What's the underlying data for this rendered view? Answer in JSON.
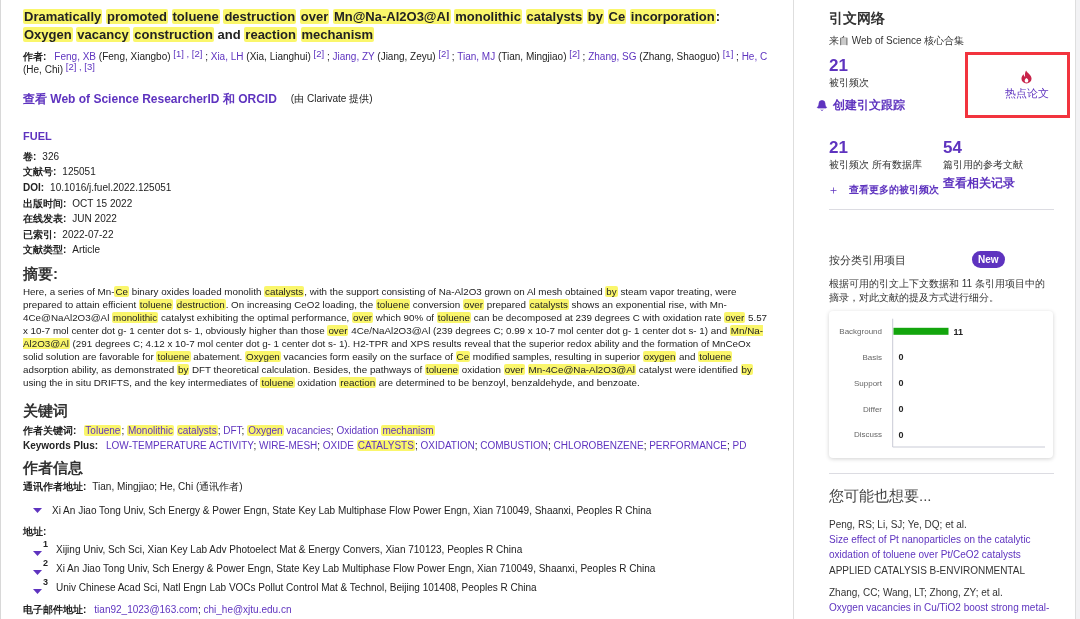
{
  "article": {
    "title": [
      {
        "text": "Dramatically ",
        "highlighted": true
      },
      {
        "text": "promoted ",
        "highlighted": true
      },
      {
        "text": "toluene ",
        "highlighted": true
      },
      {
        "text": "destruction ",
        "highlighted": true
      },
      {
        "text": "over ",
        "highlighted": true
      },
      {
        "text": "Mn@Na-Al2O3@Al ",
        "highlighted": true
      },
      {
        "text": "monolithic ",
        "highlighted": true
      },
      {
        "text": "catalysts ",
        "highlighted": true
      },
      {
        "text": "by ",
        "highlighted": true
      },
      {
        "text": "Ce ",
        "highlighted": true
      },
      {
        "text": "incorporation",
        "highlighted": true
      },
      {
        "text": ": ",
        "highlighted": false
      },
      {
        "text": "Oxygen ",
        "highlighted": true
      },
      {
        "text": "vacancy ",
        "highlighted": true
      },
      {
        "text": "construction",
        "highlighted": true
      },
      {
        "text": " and ",
        "highlighted": false
      },
      {
        "text": "reaction ",
        "highlighted": true
      },
      {
        "text": "mechanism",
        "highlighted": true
      }
    ],
    "authors": {
      "label": "作者:",
      "items": [
        {
          "short": "Feng, XB",
          "full": "(Feng, Xiangbo)",
          "refs": [
            {
              "label": "[1]",
              "separator": ","
            },
            {
              "label": "[2]"
            }
          ],
          "separator": ";"
        },
        {
          "short": "Xia, LH",
          "full": "(Xia, Lianghui)",
          "refs": [
            {
              "label": "[2]"
            }
          ],
          "separator": ";"
        },
        {
          "short": "Jiang, ZY",
          "full": "(Jiang, Zeyu)",
          "refs": [
            {
              "label": "[2]"
            }
          ],
          "separator": ";"
        },
        {
          "short": "Tian, MJ",
          "full": "(Tian, Mingjiao)",
          "refs": [
            {
              "label": "[2]"
            }
          ],
          "separator": ";"
        },
        {
          "short": "Zhang, SG",
          "full": "(Zhang, Shaoguo)",
          "refs": [
            {
              "label": "[1]"
            }
          ],
          "separator": ";"
        },
        {
          "short": "He, C",
          "full": "(He, Chi)",
          "refs": [
            {
              "label": "[2]",
              "separator": ","
            },
            {
              "label": "[3]"
            }
          ]
        }
      ]
    },
    "researcher_link": {
      "text": "查看 Web of Science ResearcherID 和 ORCID",
      "note": "(由 Clarivate 提供)"
    },
    "journal": "FUEL",
    "details": [
      {
        "label": "卷:",
        "value": "326"
      },
      {
        "label": "文献号:",
        "value": "125051"
      },
      {
        "label": "DOI:",
        "value": "10.1016/j.fuel.2022.125051"
      },
      {
        "label": "出版时间:",
        "value": "OCT 15 2022"
      },
      {
        "label": "在线发表:",
        "value": "JUN 2022"
      },
      {
        "label": "已索引:",
        "value": "2022-07-22"
      },
      {
        "label": "文献类型:",
        "value": "Article"
      }
    ],
    "abstract": {
      "heading": "摘要:",
      "segments": [
        {
          "text": "Here, a series of Mn-",
          "highlighted": false
        },
        {
          "text": "Ce",
          "highlighted": true
        },
        {
          "text": " binary oxides loaded monolith ",
          "highlighted": false
        },
        {
          "text": "catalysts",
          "highlighted": true
        },
        {
          "text": ", with the support consisting of Na-Al2O3 grown on Al mesh obtained ",
          "highlighted": false
        },
        {
          "text": "by",
          "highlighted": true
        },
        {
          "text": " steam vapor treating, were prepared to attain efficient ",
          "highlighted": false
        },
        {
          "text": "toluene ",
          "highlighted": true
        },
        {
          "text": "destruction",
          "highlighted": true
        },
        {
          "text": ". On increasing CeO2 loading, the ",
          "highlighted": false
        },
        {
          "text": "toluene",
          "highlighted": true
        },
        {
          "text": " conversion ",
          "highlighted": false
        },
        {
          "text": "over",
          "highlighted": true
        },
        {
          "text": " prepared ",
          "highlighted": false
        },
        {
          "text": "catalysts",
          "highlighted": true
        },
        {
          "text": " shows an exponential rise, with Mn-4Ce@NaAl2O3@Al ",
          "highlighted": false
        },
        {
          "text": "monolithic",
          "highlighted": true
        },
        {
          "text": " catalyst exhibiting the optimal performance, ",
          "highlighted": false
        },
        {
          "text": "over",
          "highlighted": true
        },
        {
          "text": " which 90% of ",
          "highlighted": false
        },
        {
          "text": "toluene",
          "highlighted": true
        },
        {
          "text": " can be decomposed at 239 degrees C with oxidation rate ",
          "highlighted": false
        },
        {
          "text": "over",
          "highlighted": true
        },
        {
          "text": " 5.57 x 10-7 mol center dot g- 1 center dot s- 1, obviously higher than those ",
          "highlighted": false
        },
        {
          "text": "over",
          "highlighted": true
        },
        {
          "text": " 4Ce/NaAl2O3@Al (239 degrees C; 0.99 x 10-7 mol center dot g- 1 center dot s- 1) and ",
          "highlighted": false
        },
        {
          "text": "Mn/Na-Al2O3@Al",
          "highlighted": true
        },
        {
          "text": " (291 degrees C; 4.12 x 10-7 mol center dot g- 1 center dot s- 1). H2-TPR and XPS results reveal that the superior redox ability and the formation of MnCeOx solid solution are favorable for ",
          "highlighted": false
        },
        {
          "text": "toluene",
          "highlighted": true
        },
        {
          "text": " abatement. ",
          "highlighted": false
        },
        {
          "text": "Oxygen",
          "highlighted": true
        },
        {
          "text": " vacancies form easily on the surface of ",
          "highlighted": false
        },
        {
          "text": "Ce",
          "highlighted": true
        },
        {
          "text": " modified samples, resulting in superior ",
          "highlighted": false
        },
        {
          "text": "oxygen",
          "highlighted": true
        },
        {
          "text": " and ",
          "highlighted": false
        },
        {
          "text": "toluene",
          "highlighted": true
        },
        {
          "text": " adsorption ability, as demonstrated ",
          "highlighted": false
        },
        {
          "text": "by",
          "highlighted": true
        },
        {
          "text": " DFT theoretical calculation. Besides, the pathways of ",
          "highlighted": false
        },
        {
          "text": "toluene",
          "highlighted": true
        },
        {
          "text": " oxidation ",
          "highlighted": false
        },
        {
          "text": "over ",
          "highlighted": true
        },
        {
          "text": "Mn-4Ce@Na-Al2O3@Al",
          "highlighted": true
        },
        {
          "text": " catalyst were identified ",
          "highlighted": false
        },
        {
          "text": "by",
          "highlighted": true
        },
        {
          "text": " using the in situ DRIFTS, and the key intermediates of ",
          "highlighted": false
        },
        {
          "text": "toluene",
          "highlighted": true
        },
        {
          "text": " oxidation ",
          "highlighted": false
        },
        {
          "text": "reaction",
          "highlighted": true
        },
        {
          "text": " are determined to be benzoyl, benzaldehyde, and benzoate.",
          "highlighted": false
        }
      ]
    },
    "keywords": {
      "heading": "关键词",
      "groups": [
        {
          "label": "作者关键词:",
          "items": [
            {
              "segments": [
                {
                  "text": "Toluene",
                  "highlighted": true
                }
              ],
              "separator": ";"
            },
            {
              "segments": [
                {
                  "text": "Monolithic ",
                  "highlighted": true
                },
                {
                  "text": "catalysts",
                  "highlighted": true
                }
              ],
              "separator": ";"
            },
            {
              "segments": [
                {
                  "text": "DFT",
                  "highlighted": false
                }
              ],
              "separator": ";"
            },
            {
              "segments": [
                {
                  "text": "Oxygen",
                  "highlighted": true
                },
                {
                  "text": " vacancies",
                  "highlighted": false
                }
              ],
              "separator": ";"
            },
            {
              "segments": [
                {
                  "text": "Oxidation ",
                  "highlighted": false
                },
                {
                  "text": "mechanism",
                  "highlighted": true
                }
              ]
            }
          ]
        },
        {
          "label": "Keywords Plus:",
          "items": [
            {
              "segments": [
                {
                  "text": "LOW-TEMPERATURE ACTIVITY",
                  "highlighted": false
                }
              ],
              "separator": ";"
            },
            {
              "segments": [
                {
                  "text": "WIRE-MESH",
                  "highlighted": false
                }
              ],
              "separator": ";"
            },
            {
              "segments": [
                {
                  "text": "OXIDE ",
                  "highlighted": false
                },
                {
                  "text": "CATALYSTS",
                  "highlighted": true
                }
              ],
              "separator": ";"
            },
            {
              "segments": [
                {
                  "text": "OXIDATION",
                  "highlighted": false
                }
              ],
              "separator": ";"
            },
            {
              "segments": [
                {
                  "text": "COMBUSTION",
                  "highlighted": false
                }
              ],
              "separator": ";"
            },
            {
              "segments": [
                {
                  "text": "CHLOROBENZENE",
                  "highlighted": false
                }
              ],
              "separator": ";"
            },
            {
              "segments": [
                {
                  "text": "PERFORMANCE",
                  "highlighted": false
                }
              ],
              "separator": ";"
            },
            {
              "segments": [
                {
                  "text": "PD",
                  "highlighted": false
                }
              ]
            }
          ]
        }
      ]
    },
    "author_info": {
      "heading": "作者信息",
      "corresponding": {
        "label": "通讯作者地址:",
        "value": "Tian, Mingjiao; He, Chi (通讯作者)",
        "address": "Xi An Jiao Tong Univ, Sch Energy & Power Engn, State Key Lab Multiphase Flow Power Engn, Xian 710049, Shaanxi, Peoples R China"
      },
      "addresses": {
        "label": "地址:",
        "items": [
          {
            "number": "1",
            "text": "Xijing Univ, Sch Sci, Xian Key Lab Adv Photoelect Mat & Energy Convers, Xian 710123, Peoples R China"
          },
          {
            "number": "2",
            "text": "Xi An Jiao Tong Univ, Sch Energy & Power Engn, State Key Lab Multiphase Flow Power Engn, Xian 710049, Shaanxi, Peoples R China"
          },
          {
            "number": "3",
            "text": "Univ Chinese Acad Sci, Natl Engn Lab VOCs Pollut Control Mat & Technol, Beijing 101408, Peoples R China"
          }
        ]
      },
      "email": {
        "label": "电子邮件地址:",
        "items": [
          {
            "text": "tian92_1023@163.com",
            "separator": ";"
          },
          {
            "text": "chi_he@xjtu.edu.cn"
          }
        ]
      }
    }
  },
  "sidebar": {
    "citation_network": {
      "title": "引文网络",
      "source": "来自 Web of Science 核心合集",
      "times_cited": {
        "count": "21",
        "label": "被引频次"
      },
      "create_alert": "创建引文跟踪",
      "hot_paper": {
        "label": "热点论文",
        "outlined": true
      },
      "all_databases": {
        "count": "21",
        "label": "被引频次 所有数据库"
      },
      "references": {
        "count": "54",
        "label": "篇引用的参考文献"
      },
      "more_link": "查看更多的被引频次",
      "related_link": "查看相关记录"
    },
    "citation_classification": {
      "title": "按分类引用项目",
      "badge": "New",
      "description": "根据可用的引文上下文数据和 11 条引用项目中的摘录，对此文献的提及方式进行细分。",
      "chart_data": {
        "type": "bar",
        "orientation": "horizontal",
        "categories": [
          "Background",
          "Basis",
          "Support",
          "Differ",
          "Discuss"
        ],
        "values": [
          11,
          0,
          0,
          0,
          0
        ],
        "data_labels": true
      }
    },
    "recommendations": {
      "title": "您可能也想要...",
      "items": [
        {
          "authors": "Peng, RS; Li, SJ; Ye, DQ; et al.",
          "title": "Size effect of Pt nanoparticles on the catalytic oxidation of toluene over Pt/CeO2 catalysts",
          "journal": "APPLIED CATALYSIS B-ENVIRONMENTAL"
        },
        {
          "authors": "Zhang, CC; Wang, LT; Zhong, ZY; et al.",
          "title": "Oxygen vacancies in Cu/TiO2 boost strong metal-"
        }
      ]
    }
  }
}
